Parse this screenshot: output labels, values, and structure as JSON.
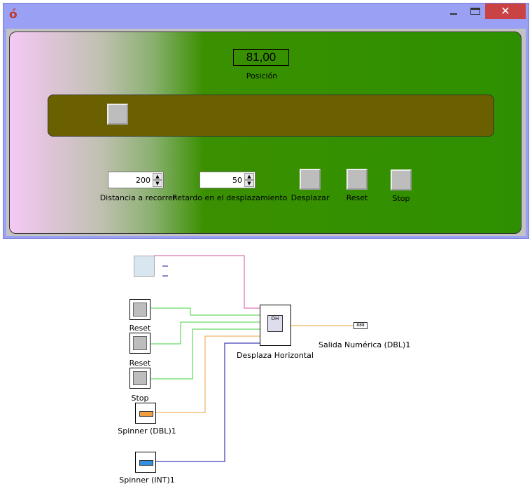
{
  "window": {
    "app_icon": "ó",
    "controls": {
      "close_label": "✕"
    }
  },
  "panel": {
    "position_value": "81,00",
    "position_label": "Posición",
    "distance": {
      "value": "200",
      "label": "Distancia a recorrer"
    },
    "delay": {
      "value": "50",
      "label": "Retardo en el desplazamiento"
    },
    "buttons": {
      "move": "Desplazar",
      "reset": "Reset",
      "stop": "Stop"
    },
    "slider_level_percent": 8
  },
  "diagram": {
    "blocks": {
      "reset1": "Reset",
      "reset2": "Reset",
      "stop": "Stop",
      "spinner_dbl": "Spinner (DBL)1",
      "spinner_int": "Spinner (INT)1",
      "main": "Desplaza Horizontal",
      "chip_text": "DH",
      "output": "Salida Numérica (DBL)1",
      "output_glyph": "888"
    },
    "wire_colors": {
      "pink": "#d050a0",
      "green": "#40d040",
      "orange": "#f0a040",
      "blue": "#1010a0"
    },
    "icons": [
      "camera-icon",
      "chip-icon",
      "numeric-display-icon"
    ]
  }
}
